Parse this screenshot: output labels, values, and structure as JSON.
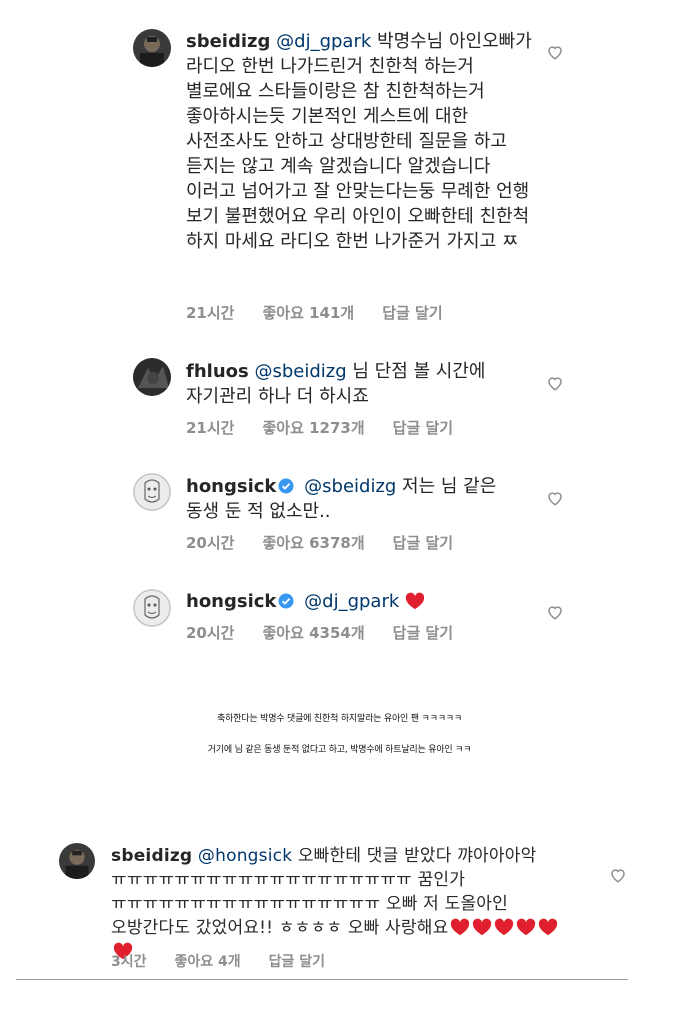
{
  "comments": [
    {
      "username": "sbeidizg",
      "mention": "@dj_gpark",
      "text": " 박명수님 아인오빠가 라디오 한번 나가드린거 친한척 하는거 별로에요 스타들이랑은 참 친한척하는거 좋아하시는듯 기본적인 게스트에 대한 사전조사도 안하고 상대방한테 질문을 하고 듣지는 않고 계속 알겠습니다 알겠습니다 이러고 넘어가고 잘 안맞는다는둥 무례한 언행 보기 불편했어요 우리 아인이 오빠한테 친한척 하지 마세요 라디오 한번 나가준거 가지고 ㅉ",
      "time": "21시간",
      "likes": "좋아요 141개",
      "reply": "답글 달기"
    },
    {
      "username": "fhluos",
      "mention": "@sbeidizg",
      "text": " 님 단점 볼 시간에 자기관리 하나 더 하시죠",
      "time": "21시간",
      "likes": "좋아요 1273개",
      "reply": "답글 달기"
    },
    {
      "username": "hongsick",
      "mention": "@sbeidizg",
      "text": " 저는 님 같은 동생 둔 적 없소만..",
      "time": "20시간",
      "likes": "좋아요 6378개",
      "reply": "답글 달기"
    },
    {
      "username": "hongsick",
      "mention": "@dj_gpark",
      "text": "",
      "time": "20시간",
      "likes": "좋아요 4354개",
      "reply": "답글 달기"
    }
  ],
  "captions": {
    "line1": "축하한다는 박명수 댓글에 친한척 하지말라는 유아인 팬 ㅋㅋㅋㅋㅋ",
    "line2": "거기에 님 같은 동생 둔적 없다고 하고, 박명수에 하트날리는 유아인 ㅋㅋ"
  },
  "lower_comment": {
    "username": "sbeidizg",
    "mention": "@hongsick",
    "text": " 오빠한테 댓글 받았다 꺄아아아악 ㅠㅠㅠㅠㅠㅠㅠㅠㅠㅠㅠㅠㅠㅠㅠㅠㅠㅠㅠ 꿈인가 ㅠㅠㅠㅠㅠㅠㅠㅠㅠㅠㅠㅠㅠㅠㅠㅠㅠ 오빠 저 도올아인 오방간다도 갔었어요!! ㅎㅎㅎㅎ 오빠 사랑해요",
    "hearts": 6,
    "time": "3시간",
    "likes": "좋아요 4개",
    "reply": "답글 달기"
  },
  "colors": {
    "mention": "#00376b",
    "verified": "#3897f0",
    "heart": "#ed4956",
    "meta": "#8e8e8e"
  },
  "icons": [
    "heart-outline-icon",
    "verified-badge-icon",
    "red-heart-emoji"
  ]
}
